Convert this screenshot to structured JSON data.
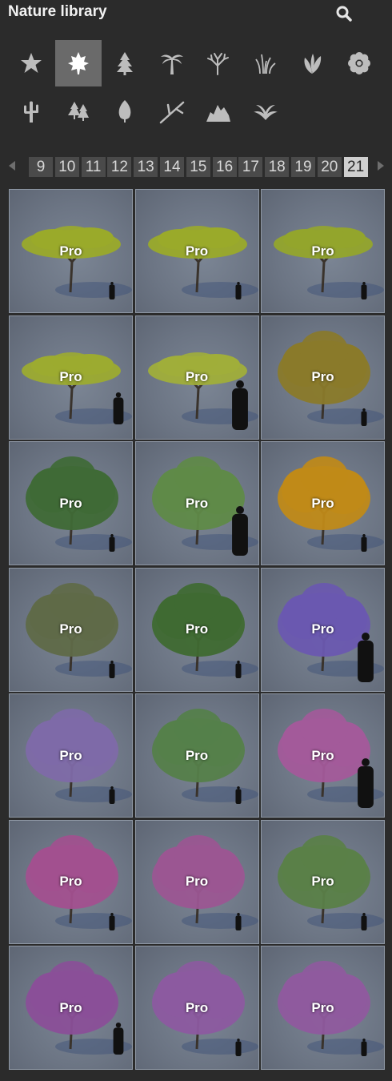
{
  "header": {
    "title": "Nature library",
    "search_icon": "search-icon"
  },
  "categories": [
    {
      "icon": "star-icon",
      "active": false
    },
    {
      "icon": "maple-leaf-icon",
      "active": true
    },
    {
      "icon": "conifer-tree-icon",
      "active": false
    },
    {
      "icon": "palm-tree-icon",
      "active": false
    },
    {
      "icon": "bare-tree-icon",
      "active": false
    },
    {
      "icon": "grass-icon",
      "active": false
    },
    {
      "icon": "shrub-leaves-icon",
      "active": false
    },
    {
      "icon": "flower-icon",
      "active": false
    },
    {
      "icon": "cactus-icon",
      "active": false
    },
    {
      "icon": "forest-icon",
      "active": false
    },
    {
      "icon": "leaf-icon",
      "active": false
    },
    {
      "icon": "branch-icon",
      "active": false
    },
    {
      "icon": "rocks-icon",
      "active": false
    },
    {
      "icon": "fern-icon",
      "active": false
    }
  ],
  "pager": {
    "prev_icon": "arrow-left-icon",
    "next_icon": "arrow-right-icon",
    "pages": [
      "9",
      "10",
      "11",
      "12",
      "13",
      "14",
      "15",
      "16",
      "17",
      "18",
      "19",
      "20",
      "21"
    ],
    "active_page": "21"
  },
  "colors": {
    "background": "#2b2b2b",
    "page_active": "#cfcfcf",
    "page_inactive": "#4a4a4a",
    "category_active": "#6a6a6a"
  },
  "thumbnails": [
    {
      "label": "Pro",
      "canopy": "#9aaa2a",
      "style": "flat",
      "person": "small"
    },
    {
      "label": "Pro",
      "canopy": "#9aaa2a",
      "style": "flat",
      "person": "small"
    },
    {
      "label": "Pro",
      "canopy": "#93a52c",
      "style": "flat",
      "person": "small"
    },
    {
      "label": "Pro",
      "canopy": "#9cab30",
      "style": "flat",
      "person": "medium"
    },
    {
      "label": "Pro",
      "canopy": "#a0ae3a",
      "style": "flat",
      "person": "large"
    },
    {
      "label": "Pro",
      "canopy": "#8a7a2a",
      "style": "round",
      "person": "small"
    },
    {
      "label": "Pro",
      "canopy": "#3f6a36",
      "style": "round",
      "person": "small"
    },
    {
      "label": "Pro",
      "canopy": "#5f8a48",
      "style": "round",
      "person": "large"
    },
    {
      "label": "Pro",
      "canopy": "#c08a18",
      "style": "round",
      "person": "small"
    },
    {
      "label": "Pro",
      "canopy": "#5f6a48",
      "style": "round",
      "person": "small"
    },
    {
      "label": "Pro",
      "canopy": "#3f6a32",
      "style": "round",
      "person": "small"
    },
    {
      "label": "Pro",
      "canopy": "#6a58b0",
      "style": "round",
      "person": "large"
    },
    {
      "label": "Pro",
      "canopy": "#7e6aa8",
      "style": "round",
      "person": "small"
    },
    {
      "label": "Pro",
      "canopy": "#55804a",
      "style": "round",
      "person": "small"
    },
    {
      "label": "Pro",
      "canopy": "#a35a9a",
      "style": "round",
      "person": "large"
    },
    {
      "label": "Pro",
      "canopy": "#a2508f",
      "style": "round",
      "person": "small"
    },
    {
      "label": "Pro",
      "canopy": "#9b5692",
      "style": "round",
      "person": "small"
    },
    {
      "label": "Pro",
      "canopy": "#5a8048",
      "style": "round",
      "person": "small"
    },
    {
      "label": "Pro",
      "canopy": "#8a4f98",
      "style": "round",
      "person": "medium"
    },
    {
      "label": "Pro",
      "canopy": "#8c5aa0",
      "style": "round",
      "person": "small"
    },
    {
      "label": "Pro",
      "canopy": "#8f5a9e",
      "style": "round",
      "person": "small"
    }
  ]
}
